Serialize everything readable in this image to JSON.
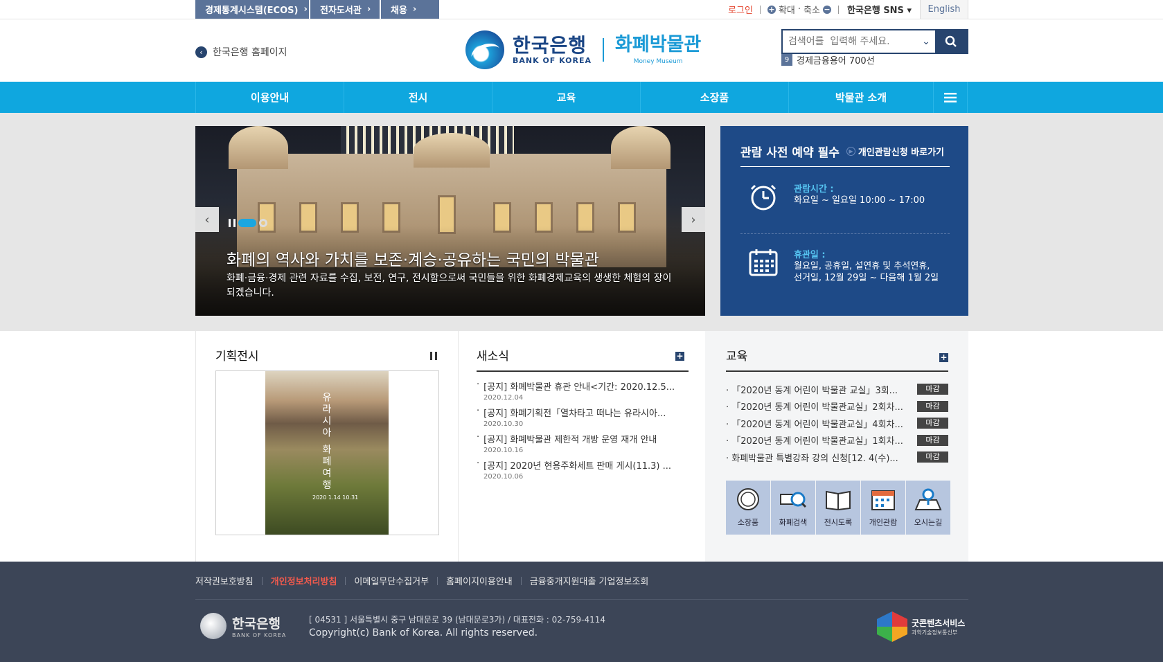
{
  "util": {
    "left_links": [
      "경제통계시스템(ECOS)",
      "전자도서관",
      "채용"
    ],
    "login": "로그인",
    "zoom_in": "확대",
    "zoom_sep": "·",
    "zoom_out": "축소",
    "sns": "한국은행 SNS",
    "english": "English"
  },
  "header": {
    "home_link": "한국은행 홈페이지",
    "logo_ko": "한국은행",
    "logo_en": "BANK OF KOREA",
    "museum_ko": "화폐박물관",
    "museum_en": "Money Museum",
    "search_placeholder": "검색어를  입력해 주세요.",
    "term_num": "9",
    "term_text": "경제금융용어 700선"
  },
  "nav": [
    "이용안내",
    "전시",
    "교육",
    "소장품",
    "박물관 소개"
  ],
  "slide": {
    "headline": "화폐의 역사와 가치를 보존·계승·공유하는 국민의 박물관",
    "desc": "화폐·금융·경제 관련 자료를 수집, 보전, 연구, 전시함으로써 국민들을 위한 화폐경제교육의 생생한 체험의 장이 되겠습니다."
  },
  "notice": {
    "title": "관람 사전 예약 필수",
    "link": "개인관람신청 바로가기",
    "hours_label": "관람시간 :",
    "hours_value": "화요일 ~ 일요일 10:00 ~ 17:00",
    "closed_label": "휴관일 :",
    "closed_value_1": "월요일, 공휴일, 설연휴 및 추석연휴,",
    "closed_value_2": "선거일, 12월 29일 ~ 다음해 1월 2일"
  },
  "special": {
    "title": "기획전시",
    "poster_title": "유라시아 화폐여행",
    "poster_date": "2020 1.14 10.31"
  },
  "news": {
    "title": "새소식",
    "items": [
      {
        "text": "[공지] 화폐박물관 휴관 안내<기간: 2020.12.5...",
        "date": "2020.12.04"
      },
      {
        "text": "[공지] 화폐기획전「열차타고 떠나는 유라시아...",
        "date": "2020.10.30"
      },
      {
        "text": "[공지] 화폐박물관 제한적 개방 운영 재개 안내",
        "date": "2020.10.16"
      },
      {
        "text": "[공지] 2020년 현용주화세트 판매 게시(11.3) ...",
        "date": "2020.10.06"
      }
    ]
  },
  "edu": {
    "title": "교육",
    "items": [
      {
        "text": "「2020년 동계 어린이 박물관 교실」3회...",
        "badge": "마감"
      },
      {
        "text": "「2020년 동계 어린이 박물관교실」2회차...",
        "badge": "마감"
      },
      {
        "text": "「2020년 동계 어린이 박물관교실」4회차...",
        "badge": "마감"
      },
      {
        "text": "「2020년 동계 어린이 박물관교실」1회차...",
        "badge": "마감"
      },
      {
        "text": "화폐박물관 특별강좌 강의 신청[12. 4(수)...",
        "badge": "마감"
      }
    ],
    "quick": [
      "소장품",
      "화폐검색",
      "전시도록",
      "개인관람",
      "오시는길"
    ]
  },
  "footer": {
    "links": [
      "저작권보호방침",
      "개인정보처리방침",
      "이메일무단수집거부",
      "홈페이지이용안내",
      "금융중개지원대출 기업정보조회"
    ],
    "logo_ko": "한국은행",
    "logo_en": "BANK OF KOREA",
    "address": "[ 04531 ] 서울특별시 중구 남대문로 39 (남대문로3가) / 대표전화 : 02-759-4114",
    "copyright": "Copyright(c) Bank of Korea. All rights reserved.",
    "gc_title": "굿콘텐츠서비스",
    "gc_sub": "과학기술정보통신부"
  },
  "colors": {
    "navy": "#27446e",
    "sky": "#0fa7df",
    "notice_bg": "#1e4a87",
    "footer_bg": "#3c4557"
  }
}
